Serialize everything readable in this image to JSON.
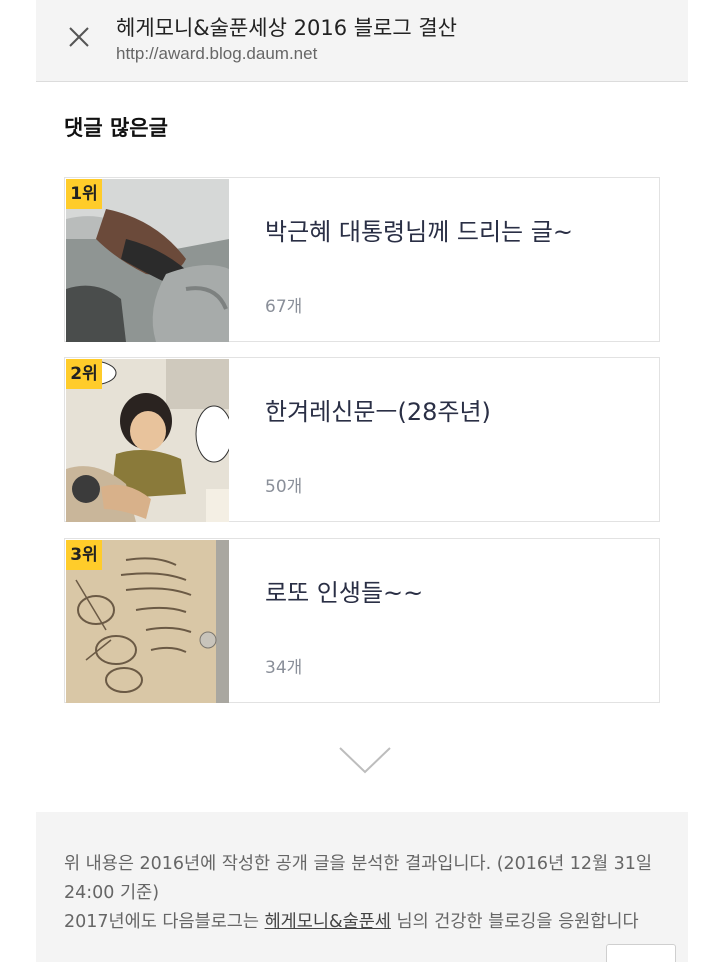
{
  "header": {
    "title": "헤게모니&술푼세상 2016 블로그 결산",
    "url": "http://award.blog.daum.net"
  },
  "section": {
    "title": "댓글 많은글"
  },
  "posts": [
    {
      "rank": "1위",
      "title": "박근혜 대통령님께 드리는 글~",
      "count": "67개"
    },
    {
      "rank": "2위",
      "title": "한겨레신문ㅡ(28주년)",
      "count": "50개"
    },
    {
      "rank": "3위",
      "title": "로또 인생들~~",
      "count": "34개"
    }
  ],
  "footer": {
    "line1": "위 내용은 2016년에 작성한 공개 글을 분석한 결과입니다. (2016년 12월 31일 24:00 기준)",
    "line2_prefix": "2017년에도 다음블로그는 ",
    "blog_link": "헤게모니&술푼세",
    "line2_suffix": " 님의 건강한 블로깅을 응원합니다"
  },
  "icons": {
    "close": "close-icon",
    "more": "chevron-down-icon"
  },
  "colors": {
    "rank_badge": "#ffcc2a",
    "title_text": "#2a2f45",
    "count_text": "#8a8f99"
  }
}
